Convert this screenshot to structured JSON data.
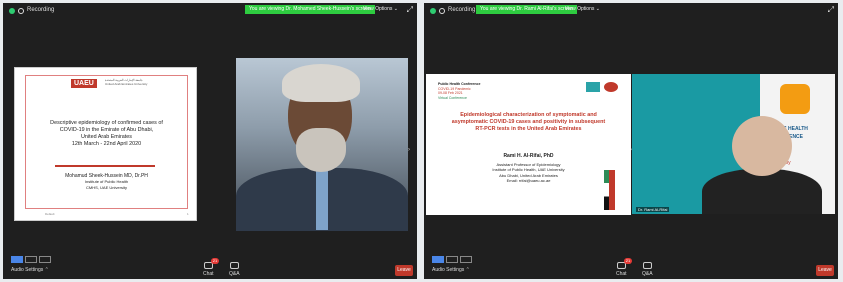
{
  "left": {
    "recording": "Recording",
    "viewing": "You are viewing Dr. Mohamed Sheek-Hussein's screen",
    "view_options": "View Options ⌄",
    "slide": {
      "logo": "UAEU",
      "logo_sub": "جامعة الإمارات العربية المتحدة\nUnited Arab Emirates University",
      "title1": "Descriptive epidemiology of confirmed cases of",
      "title2": "COVID-19 in the Emirate of Abu Dhabi,",
      "title3": "United Arab Emirates",
      "dates": "12th March - 22nd April 2020",
      "author": "Mohamud Sheek-Hussein MD, Dr.PH",
      "affil1": "Institute of Public Health",
      "affil2": "CMHS, UAE University",
      "footer_left": "Default",
      "footer_right": "1"
    },
    "audio_settings": "Audio Settings ⌃",
    "chat": "Chat",
    "chat_badge": "21",
    "qa": "Q&A",
    "leave": "Leave"
  },
  "right": {
    "recording": "Recording",
    "viewing": "You are viewing Dr. Rami Al-Rifai's screen",
    "view_options": "View Options ⌄",
    "slide": {
      "conf1": "Public Health Conference",
      "conf2": "COVID-19 Pandemic",
      "conf3": "09-08 Feb 2021",
      "conf4": "Virtual Conference",
      "title1": "Epidemiological characterization of symptomatic and",
      "title2": "asymptomatic COVID-19 cases and positivity in subsequent",
      "title3": "RT-PCR tests in the United Arab Emirates",
      "author": "Rami H. Al-Rifai, PhD",
      "affil1": "Assistant Professor of Epidemiology",
      "affil2": "Institute of Public Health, UAE University",
      "affil3": "Abu Dhabi, United Arab Emirates",
      "email": "Email: rrifai@uaeu.ac.ae"
    },
    "video_name": "Dr. Rami Al-Rifai",
    "video_text1": "PUBLIC HEALTH",
    "video_text2": "CONFERENCE",
    "video_text3": "nized by",
    "audio_settings": "Audio Settings ⌃",
    "chat": "Chat",
    "chat_badge": "21",
    "qa": "Q&A",
    "leave": "Leave"
  },
  "colors": {
    "accent_green": "#2ecc40",
    "leave_red": "#c0392b",
    "slide_title_red": "#c0392b",
    "teal": "#1a9aa3"
  }
}
